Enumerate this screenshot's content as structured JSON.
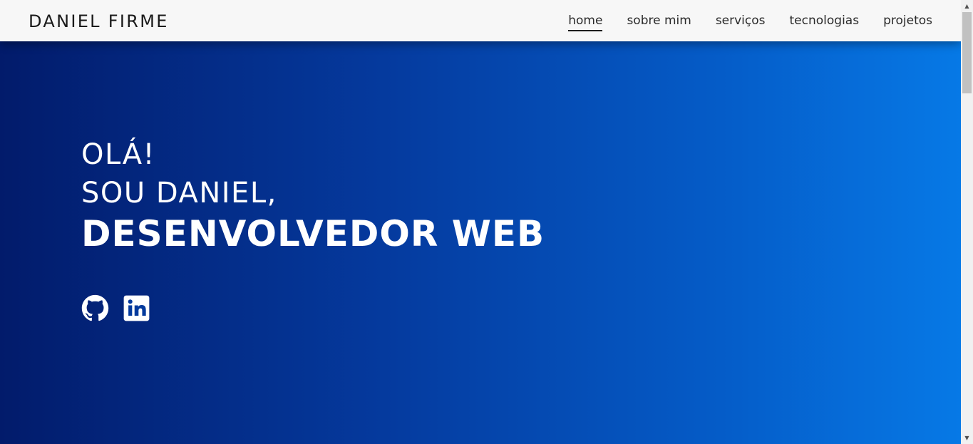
{
  "header": {
    "brand": "DANIEL FIRME",
    "nav": [
      {
        "label": "home",
        "active": true
      },
      {
        "label": "sobre mim",
        "active": false
      },
      {
        "label": "serviços",
        "active": false
      },
      {
        "label": "tecnologias",
        "active": false
      },
      {
        "label": "projetos",
        "active": false
      }
    ]
  },
  "hero": {
    "line1": "OLÁ!",
    "line2": "SOU DANIEL,",
    "line3": "DESENVOLVEDOR WEB",
    "socials": [
      {
        "icon": "github-icon"
      },
      {
        "icon": "linkedin-icon"
      }
    ]
  },
  "colors": {
    "header_bg": "#f7f7f7",
    "gradient_start": "#021b6b",
    "gradient_end": "#0679e6",
    "hero_text": "#ffffff"
  }
}
